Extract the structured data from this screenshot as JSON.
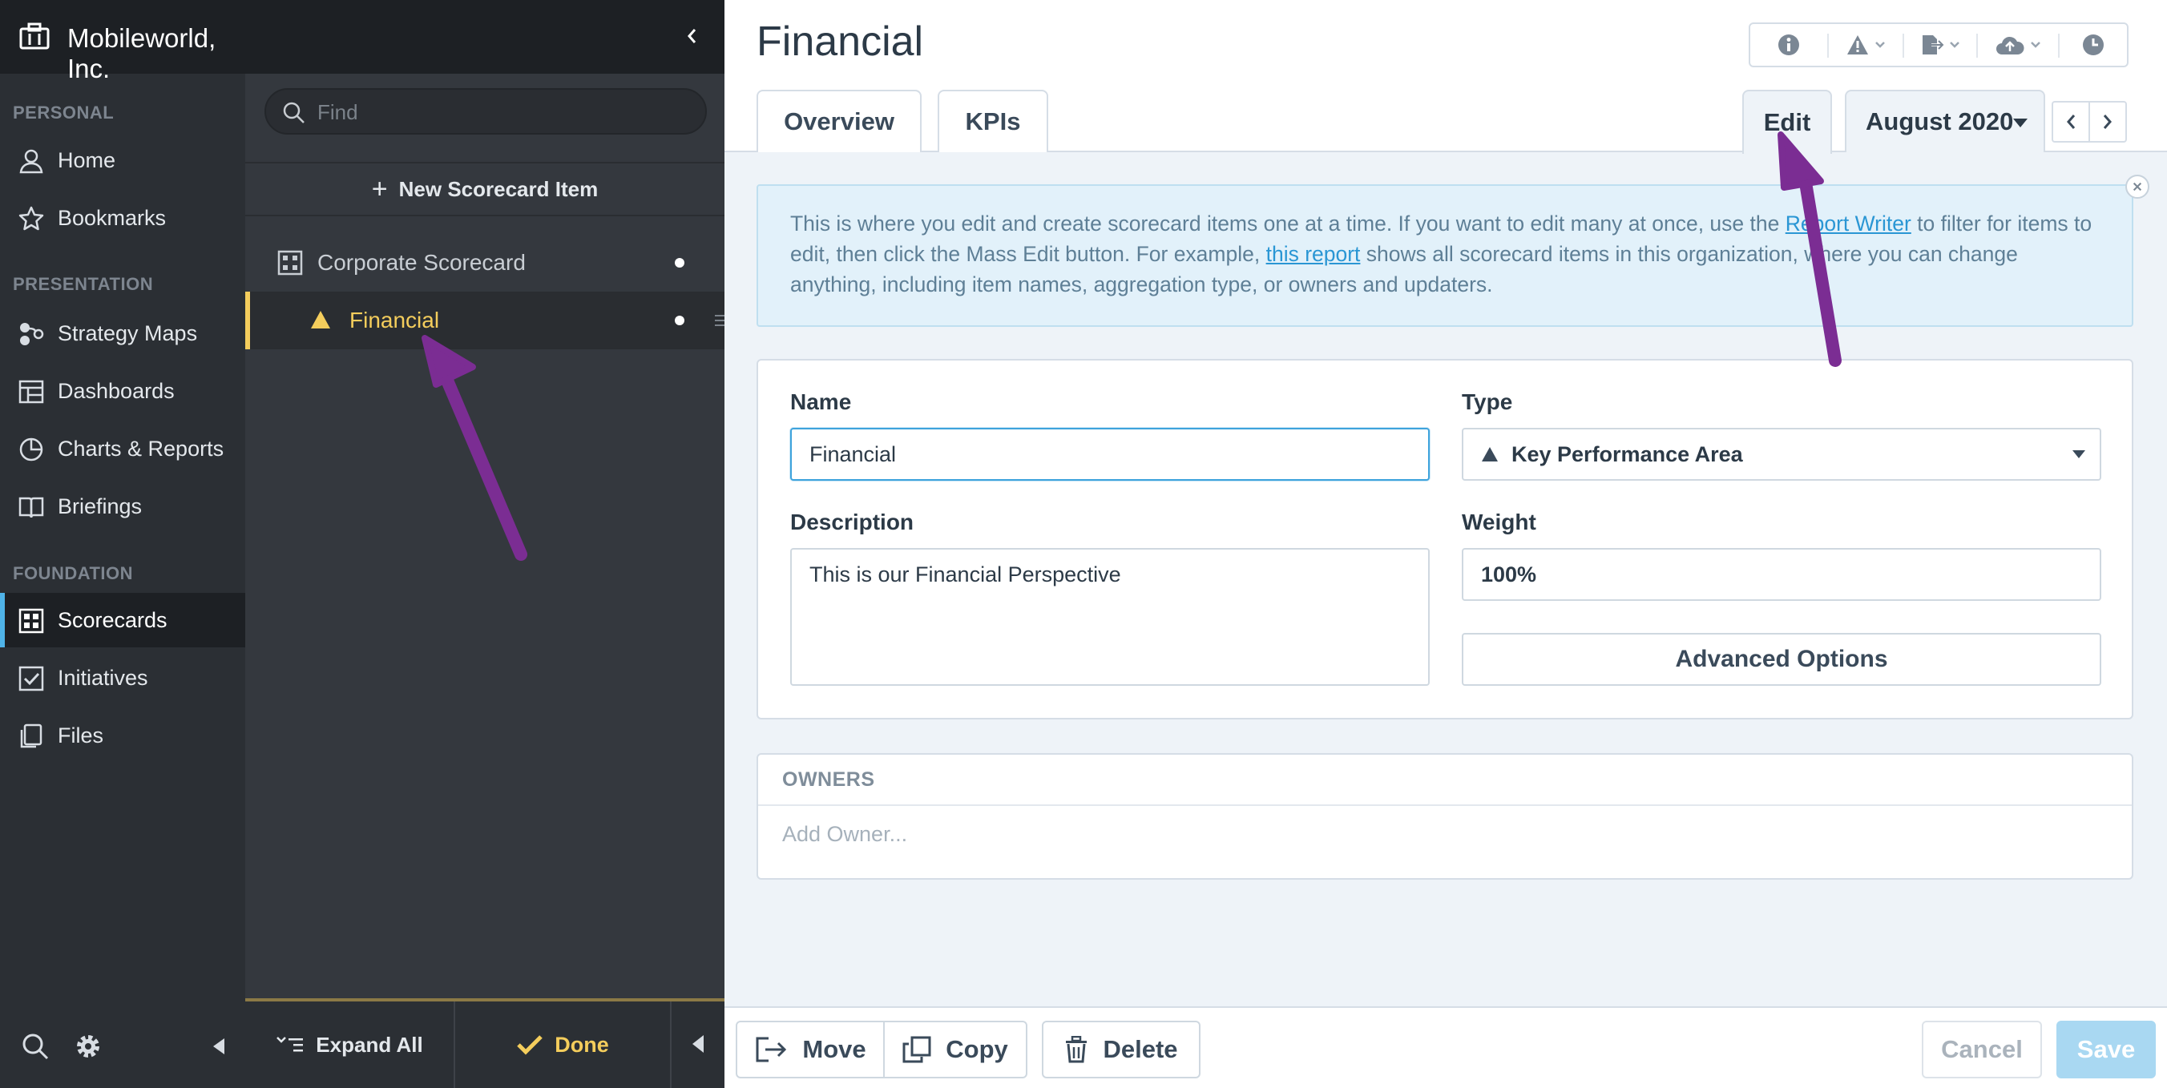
{
  "org_name": "Mobileworld, Inc.",
  "nav": {
    "sections": {
      "personal": "PERSONAL",
      "presentation": "PRESENTATION",
      "foundation": "FOUNDATION"
    },
    "items": {
      "home": "Home",
      "bookmarks": "Bookmarks",
      "strategy_maps": "Strategy Maps",
      "dashboards": "Dashboards",
      "charts_reports": "Charts & Reports",
      "briefings": "Briefings",
      "scorecards": "Scorecards",
      "initiatives": "Initiatives",
      "files": "Files"
    },
    "active": "scorecards"
  },
  "tree": {
    "search_placeholder": "Find",
    "new_item": "New Scorecard Item",
    "rows": {
      "corporate": "Corporate Scorecard",
      "financial": "Financial"
    },
    "footer": {
      "expand_all": "Expand All",
      "done": "Done"
    }
  },
  "main": {
    "title": "Financial",
    "tabs": {
      "overview": "Overview",
      "kpis": "KPIs",
      "edit": "Edit"
    },
    "period": "August 2020",
    "info": {
      "t1": "This is where you edit and create scorecard items one at a time. If you want to edit many at once, use the ",
      "link1": "Report Writer",
      "t2": " to filter for items to edit, then click the Mass Edit button. For example, ",
      "link2": "this report",
      "t3": " shows all scorecard items in this organization, where you can change anything, including item names, aggregation type, or owners and updaters."
    },
    "form": {
      "name_label": "Name",
      "name_value": "Financial",
      "type_label": "Type",
      "type_value": "Key Performance Area",
      "description_label": "Description",
      "description_value": "This is our Financial Perspective",
      "weight_label": "Weight",
      "weight_value": "100%",
      "advanced": "Advanced Options"
    },
    "owners": {
      "heading": "OWNERS",
      "add": "Add Owner..."
    },
    "actions": {
      "move": "Move",
      "copy": "Copy",
      "delete": "Delete",
      "cancel": "Cancel",
      "save": "Save"
    }
  },
  "colors": {
    "accent": "#4fb3e8",
    "selected": "#f4cd5c",
    "annotation": "#7b2d93"
  }
}
